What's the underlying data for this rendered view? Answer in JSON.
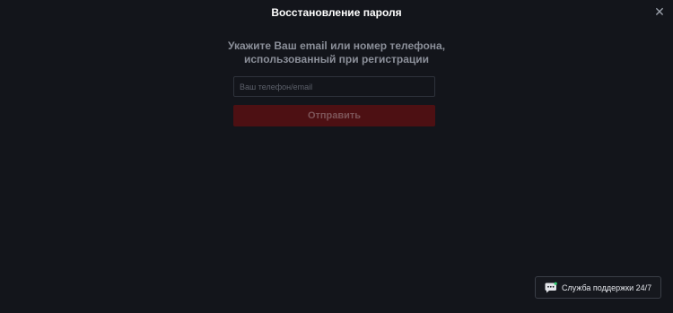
{
  "modal": {
    "title": "Восстановление пароля",
    "close_icon": "close-icon",
    "subtitle_line1": "Укажите Ваш email или номер телефона,",
    "subtitle_line2": "использованный при регистрации",
    "input": {
      "value": "",
      "placeholder": "Ваш телефон/email"
    },
    "submit_label": "Отправить"
  },
  "support": {
    "label": "Служба поддержки 24/7",
    "icon": "chat-support-icon"
  },
  "colors": {
    "background": "#13151b",
    "submit_bg": "#4d1013",
    "title": "#ffffff",
    "subtitle": "#8b8f99"
  }
}
